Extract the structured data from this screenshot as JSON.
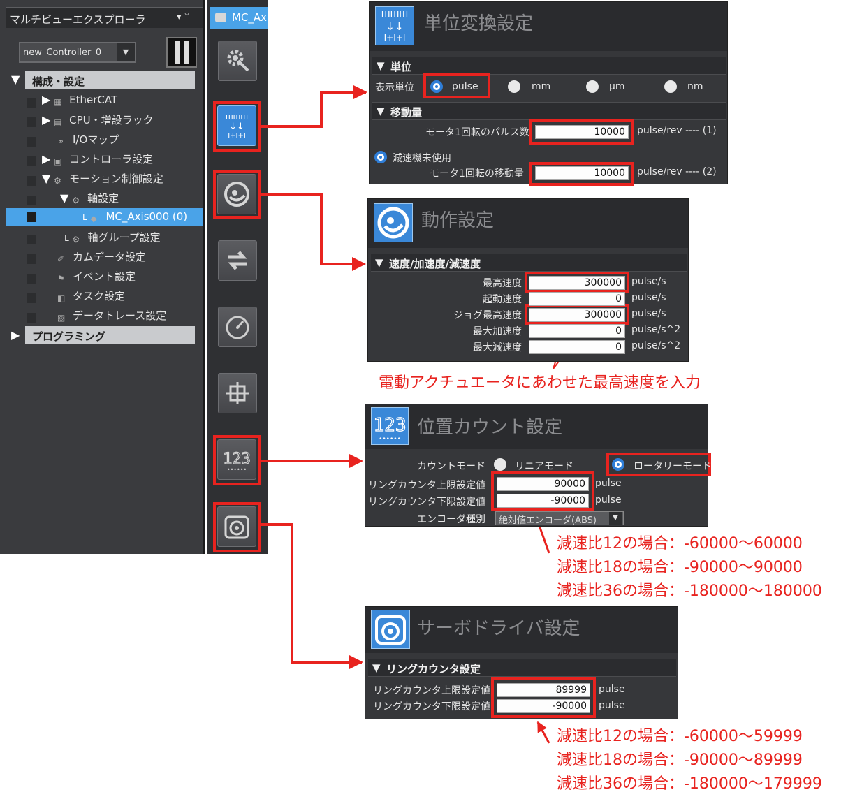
{
  "explorer": {
    "title": "マルチビューエクスプローラ",
    "pin": "▾ ᛘ",
    "controller": "new_Controller_0",
    "sections": {
      "config": "構成・設定",
      "programming": "プログラミング"
    },
    "tree": {
      "ethercat": "EtherCAT",
      "cpu": "CPU・増設ラック",
      "io": "I/Oマップ",
      "controller_settings": "コントローラ設定",
      "motion": "モーション制御設定",
      "axis_settings": "軸設定",
      "axis": "MC_Axis000 (0)",
      "axis_group": "軸グループ設定",
      "cam": "カムデータ設定",
      "event": "イベント設定",
      "task": "タスク設定",
      "trace": "データトレース設定"
    }
  },
  "tab": {
    "label": "MC_Ax"
  },
  "unit_panel": {
    "title": "単位変換設定",
    "icon_text": "ШШШ",
    "unit_section": "単位",
    "display_unit_label": "表示単位",
    "options": [
      "pulse",
      "mm",
      "μm",
      "nm"
    ],
    "travel_section": "移動量",
    "pulses_label": "モータ1回転のパルス数",
    "pulses_value": "10000",
    "pulses_unit": "pulse/rev ---- (1)",
    "no_gear_label": "減速機未使用",
    "travel_label": "モータ1回転の移動量",
    "travel_value": "10000",
    "travel_unit": "pulse/rev ---- (2)"
  },
  "operation_panel": {
    "title": "動作設定",
    "section": "速度/加速度/減速度",
    "rows": [
      {
        "label": "最高速度",
        "value": "300000",
        "unit": "pulse/s"
      },
      {
        "label": "起動速度",
        "value": "0",
        "unit": "pulse/s"
      },
      {
        "label": "ジョグ最高速度",
        "value": "300000",
        "unit": "pulse/s"
      },
      {
        "label": "最大加速度",
        "value": "0",
        "unit": "pulse/s^2"
      },
      {
        "label": "最大減速度",
        "value": "0",
        "unit": "pulse/s^2"
      }
    ],
    "note": "電動アクチュエータにあわせた最高速度を入力"
  },
  "position_panel": {
    "title": "位置カウント設定",
    "icon_text": "123",
    "count_mode_label": "カウントモード",
    "linear": "リニアモード",
    "rotary": "ロータリーモード",
    "upper_label": "リングカウンタ上限設定値",
    "upper_value": "90000",
    "lower_label": "リングカウンタ下限設定値",
    "lower_value": "-90000",
    "unit": "pulse",
    "encoder_label": "エンコーダ種別",
    "encoder_value": "絶対値エンコーダ(ABS)",
    "notes": [
      "減速比12の場合：-60000～60000",
      "減速比18の場合：-90000～90000",
      "減速比36の場合：-180000～180000"
    ]
  },
  "servo_panel": {
    "title": "サーボドライバ設定",
    "section": "リングカウンタ設定",
    "upper_label": "リングカウンタ上限設定値",
    "upper_value": "89999",
    "lower_label": "リングカウンタ下限設定値",
    "lower_value": "-90000",
    "unit": "pulse",
    "notes": [
      "減速比12の場合：-60000～59999",
      "減速比18の場合：-90000～89999",
      "減速比36の場合：-180000～179999"
    ]
  },
  "colors": {
    "highlight": "#e8231f",
    "accent": "#3a88d8",
    "selection": "#4aa3e8"
  },
  "icons": [
    "gear-wand-icon",
    "unit-conversion-icon",
    "operation-icon",
    "swap-arrows-icon",
    "gauge-icon",
    "crosshair-icon",
    "position-count-icon",
    "servo-driver-icon"
  ]
}
